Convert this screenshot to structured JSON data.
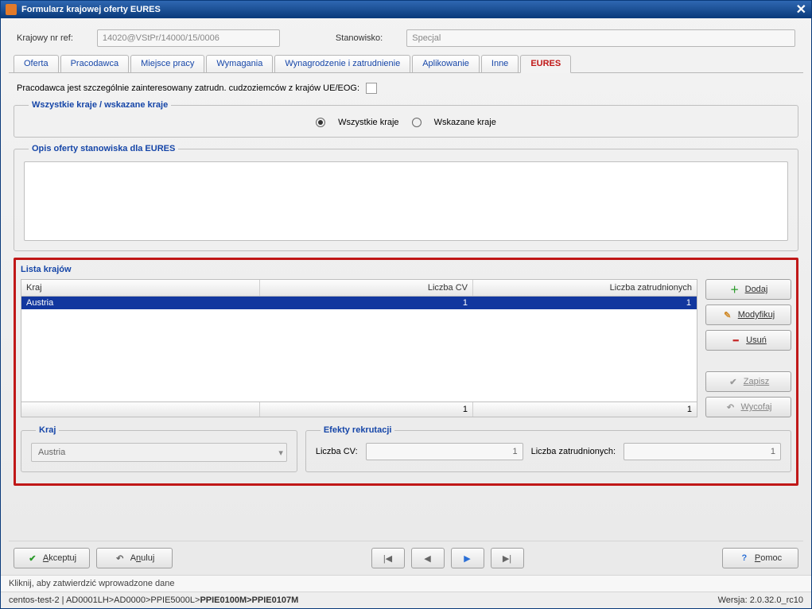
{
  "window": {
    "title": "Formularz krajowej oferty EURES"
  },
  "topRow": {
    "refLabel": "Krajowy nr ref:",
    "refValue": "14020@VStPr/14000/15/0006",
    "posLabel": "Stanowisko:",
    "posValue": "Specjal"
  },
  "tabs": {
    "items": [
      {
        "label": "Oferta"
      },
      {
        "label": "Pracodawca"
      },
      {
        "label": "Miejsce pracy"
      },
      {
        "label": "Wymagania"
      },
      {
        "label": "Wynagrodzenie i zatrudnienie"
      },
      {
        "label": "Aplikowanie"
      },
      {
        "label": "Inne"
      },
      {
        "label": "EURES"
      }
    ],
    "active": 7
  },
  "eures": {
    "checkLabel": "Pracodawca jest szczególnie zainteresowany zatrudn. cudzoziemców z krajów UE/EOG:",
    "countriesFieldset": "Wszystkie kraje / wskazane kraje",
    "radioAll": "Wszystkie kraje",
    "radioSel": "Wskazane kraje",
    "descFieldset": "Opis oferty stanowiska dla EURES",
    "listTitle": "Lista krajów",
    "columns": {
      "kraj": "Kraj",
      "cv": "Liczba CV",
      "zat": "Liczba zatrudnionych"
    },
    "rows": [
      {
        "kraj": "Austria",
        "cv": "1",
        "zat": "1"
      }
    ],
    "footer": {
      "cv": "1",
      "zat": "1"
    },
    "buttons": {
      "add": "Dodaj",
      "edit": "Modyfikuj",
      "del": "Usuń",
      "save": "Zapisz",
      "cancel": "Wycofaj"
    },
    "krajFieldset": "Kraj",
    "krajValue": "Austria",
    "effFieldset": "Efekty rekrutacji",
    "effCvLabel": "Liczba CV:",
    "effCvValue": "1",
    "effZatLabel": "Liczba zatrudnionych:",
    "effZatValue": "1"
  },
  "actionBar": {
    "accept": "Akceptuj",
    "cancel": "Anuluj",
    "help": "Pomoc"
  },
  "tooltip": "Kliknij, aby zatwierdzić wprowadzone dane",
  "status": {
    "left": "centos-test-2 | AD0001LH>AD0000>PPIE5000L>",
    "leftBold": "PPIE0100M>PPIE0107M",
    "right": "Wersja: 2.0.32.0_rc10"
  }
}
